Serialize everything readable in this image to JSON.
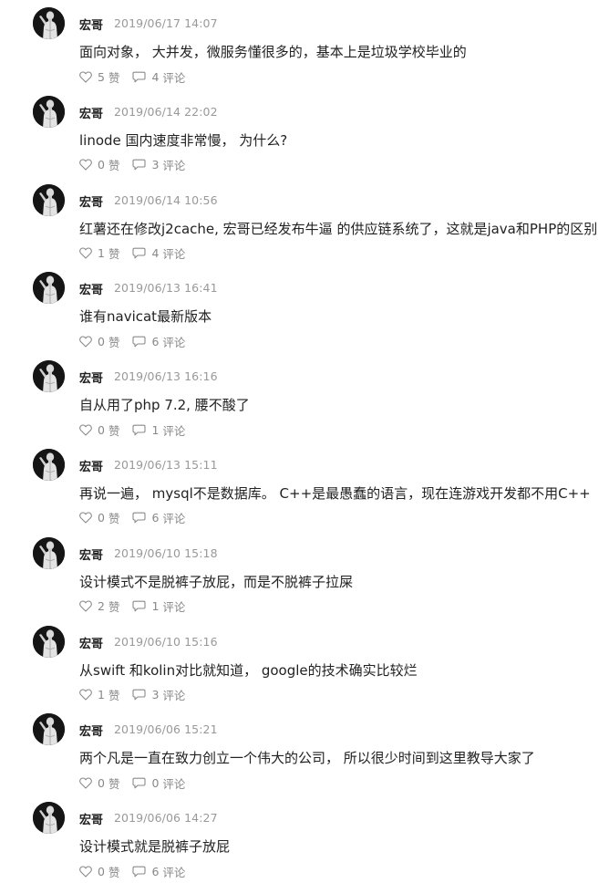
{
  "posts": [
    {
      "author": "宏哥",
      "time": "2019/06/17 14:07",
      "content": "面向对象， 大并发，微服务懂很多的，基本上是垃圾学校毕业的",
      "likes": "5",
      "comments": "4"
    },
    {
      "author": "宏哥",
      "time": "2019/06/14 22:02",
      "content": "linode 国内速度非常慢， 为什么?",
      "likes": "0",
      "comments": "3"
    },
    {
      "author": "宏哥",
      "time": "2019/06/14 10:56",
      "content": "红薯还在修改j2cache, 宏哥已经发布牛逼 的供应链系统了，这就是java和PHP的区别",
      "likes": "1",
      "comments": "4"
    },
    {
      "author": "宏哥",
      "time": "2019/06/13 16:41",
      "content": "谁有navicat最新版本",
      "likes": "0",
      "comments": "6"
    },
    {
      "author": "宏哥",
      "time": "2019/06/13 16:16",
      "content": "自从用了php 7.2, 腰不酸了",
      "likes": "0",
      "comments": "1"
    },
    {
      "author": "宏哥",
      "time": "2019/06/13 15:11",
      "content": "再说一遍， mysql不是数据库。 C++是最愚蠢的语言，现在连游戏开发都不用C++",
      "likes": "0",
      "comments": "6"
    },
    {
      "author": "宏哥",
      "time": "2019/06/10 15:18",
      "content": "设计模式不是脱裤子放屁，而是不脱裤子拉屎",
      "likes": "2",
      "comments": "1"
    },
    {
      "author": "宏哥",
      "time": "2019/06/10 15:16",
      "content": "从swift 和kolin对比就知道， google的技术确实比较烂",
      "likes": "1",
      "comments": "3"
    },
    {
      "author": "宏哥",
      "time": "2019/06/06 15:21",
      "content": "两个凡是一直在致力创立一个伟大的公司， 所以很少时间到这里教导大家了",
      "likes": "0",
      "comments": "0"
    },
    {
      "author": "宏哥",
      "time": "2019/06/06 14:27",
      "content": "设计模式就是脱裤子放屁",
      "likes": "0",
      "comments": "6"
    }
  ],
  "labels": {
    "like": "赞",
    "comment": "评论"
  },
  "icons": {
    "like": "heart-icon",
    "comment": "comment-icon",
    "avatar": "statue-avatar"
  },
  "colors": {
    "text": "#222222",
    "meta": "#999999",
    "actions": "#888888"
  }
}
